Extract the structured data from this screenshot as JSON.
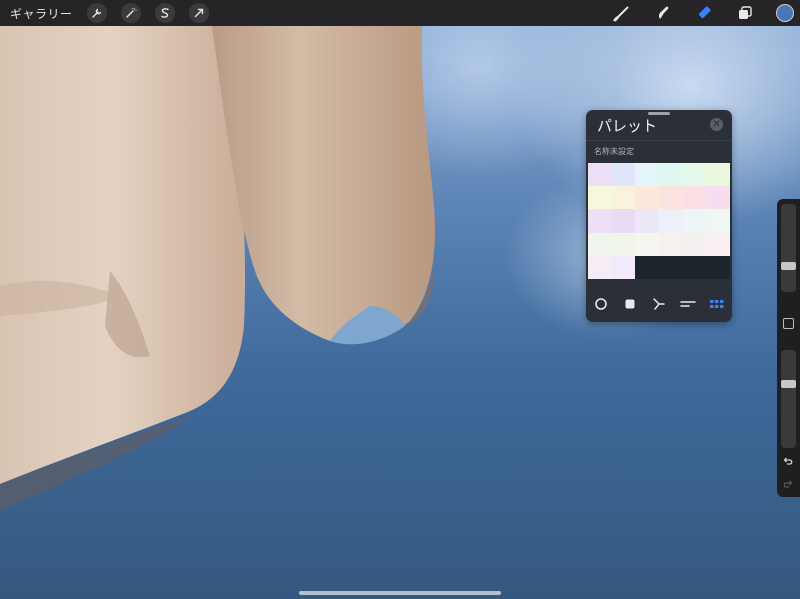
{
  "topbar": {
    "gallery_label": "ギャラリー",
    "left_tools": [
      {
        "name": "actions-wrench-icon"
      },
      {
        "name": "adjustments-wand-icon"
      },
      {
        "name": "selection-s-icon"
      },
      {
        "name": "transform-arrow-icon"
      }
    ],
    "right_tools": [
      {
        "name": "brush-icon",
        "active": false
      },
      {
        "name": "smudge-icon",
        "active": false
      },
      {
        "name": "eraser-icon",
        "active": true
      },
      {
        "name": "layers-icon",
        "active": false
      }
    ],
    "current_color": "#4a76b8",
    "accent_color": "#3b82f6"
  },
  "sidebar": {
    "brush_size_level": 0.27,
    "opacity_level": 0.67
  },
  "palette": {
    "title": "パレット",
    "name": "名称未設定",
    "swatches": [
      "#ecdff6",
      "#e0e6fb",
      "#e3f5f8",
      "#e0f7f1",
      "#e4f7e8",
      "#eaf8dc",
      "#f6f7dc",
      "#fbf2dc",
      "#fce9dc",
      "#fbe4df",
      "#fcdfe4",
      "#f6def0",
      "#efdff6",
      "#e8dcf4",
      "#ede8f7",
      "#eeeff8",
      "#eef5f7",
      "#eef7f4",
      "#eef5ec",
      "#f2f6e9",
      "#f6f5ef",
      "#f7f1ee",
      "#f6eff0",
      "#f7eff1",
      "#f5ecf6",
      "#f2eafa",
      "#1b252b",
      "#1b252b",
      "#1b252b",
      "#1b252b"
    ],
    "mode_tabs": [
      {
        "name": "disc-mode-icon"
      },
      {
        "name": "classic-mode-icon"
      },
      {
        "name": "harmony-mode-icon"
      },
      {
        "name": "value-mode-icon"
      },
      {
        "name": "palette-grid-mode-icon",
        "active": true
      }
    ]
  }
}
